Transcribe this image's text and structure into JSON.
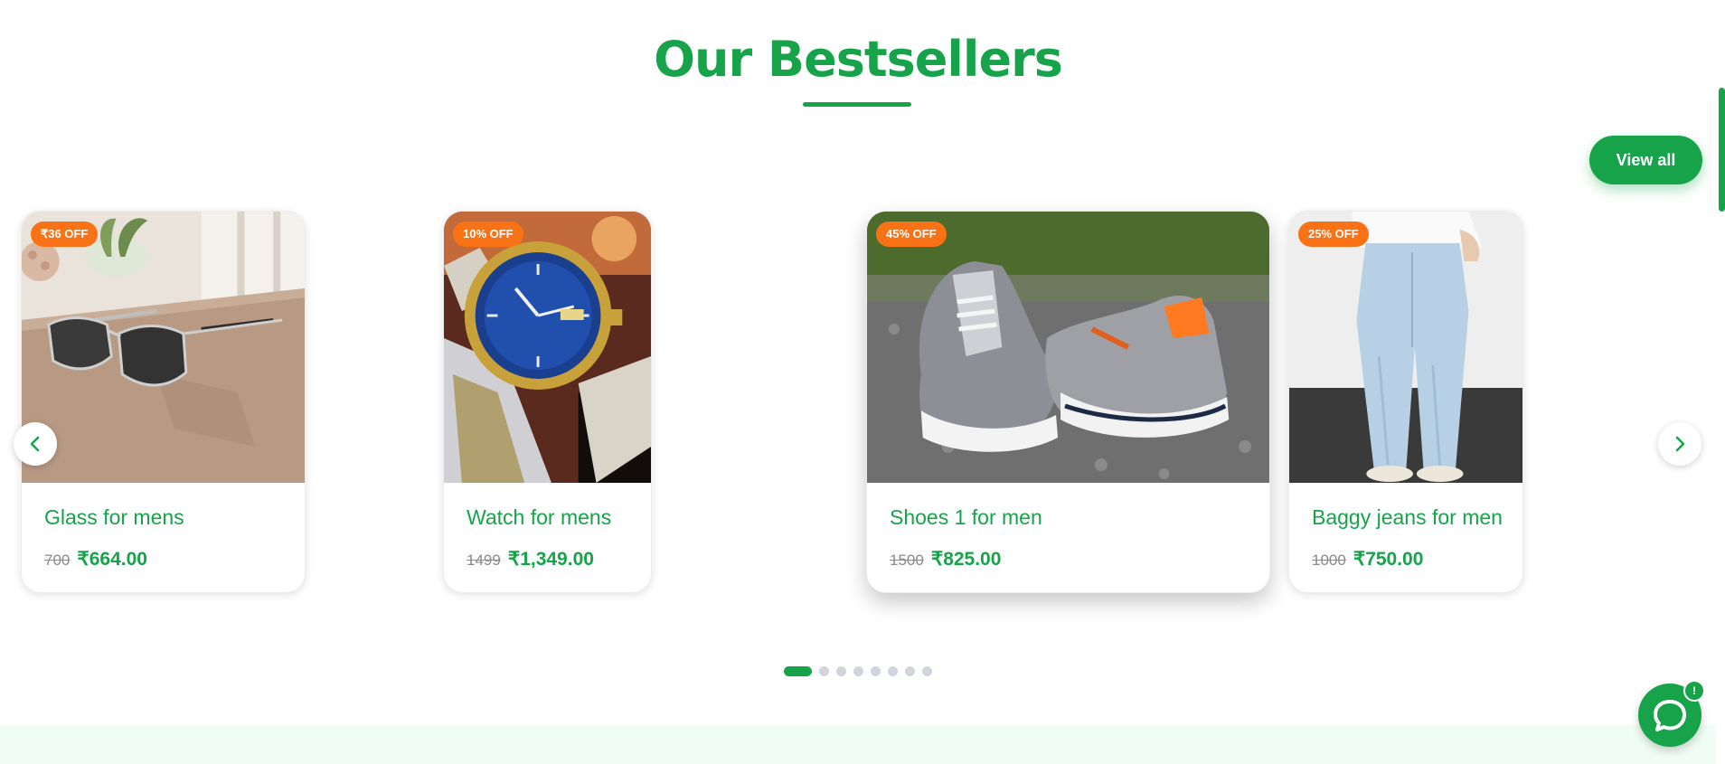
{
  "section": {
    "title": "Our Bestsellers",
    "view_all_label": "View all"
  },
  "products": [
    {
      "name": "Glass for mens",
      "badge": "₹36 OFF",
      "old_price": "700",
      "price": "₹664.00"
    },
    {
      "name": "Watch for mens",
      "badge": "10% OFF",
      "old_price": "1499",
      "price": "₹1,349.00"
    },
    {
      "name": "Shoes 1 for men",
      "badge": "45% OFF",
      "old_price": "1500",
      "price": "₹825.00"
    },
    {
      "name": "Baggy jeans for men",
      "badge": "25% OFF",
      "old_price": "1000",
      "price": "₹750.00"
    }
  ],
  "carousel": {
    "total_slides": 8,
    "active_slide": 1
  },
  "chat": {
    "badge": "!"
  },
  "icons": {
    "prev": "chevron-left-icon",
    "next": "chevron-right-icon",
    "chat": "chat-bubble-icon"
  },
  "colors": {
    "brand": "#16a34a",
    "badge": "#f97316",
    "muted": "#8a8a8a"
  }
}
